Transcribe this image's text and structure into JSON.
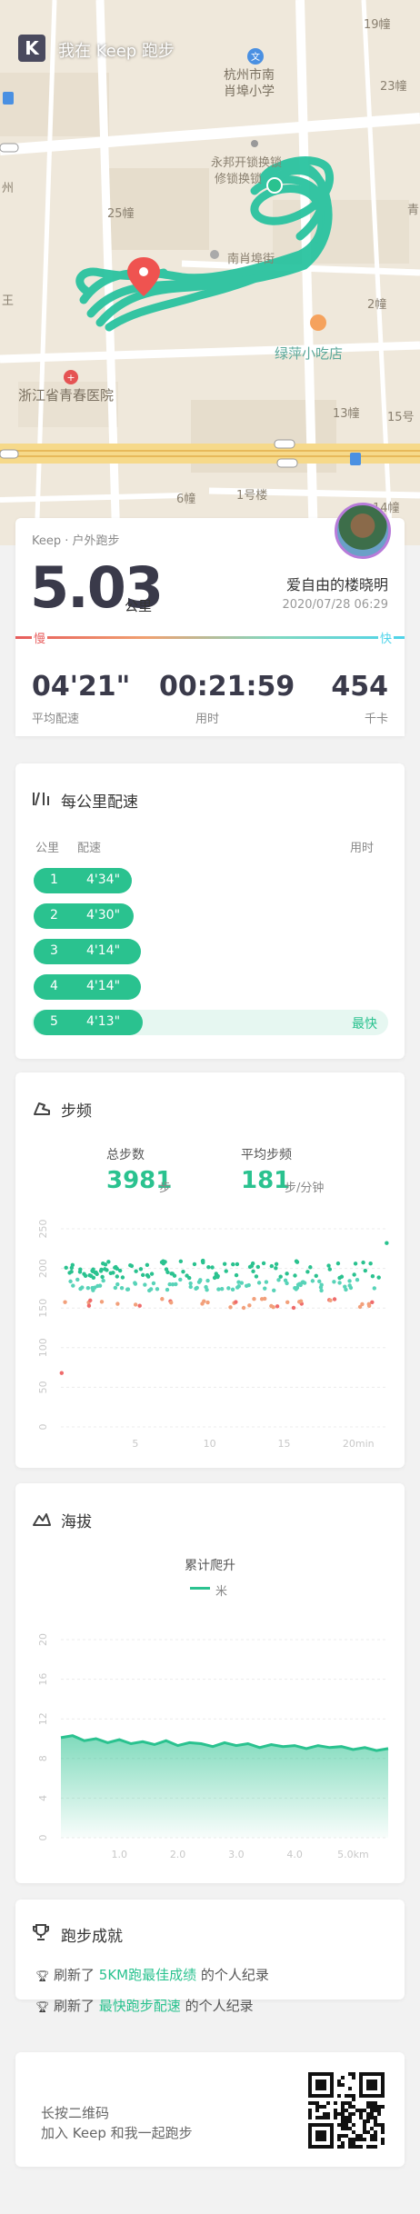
{
  "header": {
    "logo_letter": "K",
    "title": "我在 Keep 跑步"
  },
  "map_labels": [
    {
      "text": "19幢"
    },
    {
      "text": "23幢"
    },
    {
      "text": "杭州市南"
    },
    {
      "text": "肖埠小学"
    },
    {
      "text": "永邦开锁换锁"
    },
    {
      "text": "修锁换锁"
    },
    {
      "text": "25幢"
    },
    {
      "text": "南肖埠街"
    },
    {
      "text": "2幢"
    },
    {
      "text": "绿萍小吃店"
    },
    {
      "text": "浙江省青春医院"
    },
    {
      "text": "13幢"
    },
    {
      "text": "15号"
    },
    {
      "text": "6幢"
    },
    {
      "text": "1号楼"
    },
    {
      "text": "14幢"
    },
    {
      "text": "青"
    },
    {
      "text": "王"
    },
    {
      "text": "州"
    }
  ],
  "summary": {
    "source": "Keep · 户外跑步",
    "distance": "5.03",
    "distance_unit": "公里",
    "user_name": "爱自由的楼晓明",
    "datetime": "2020/07/28 06:29",
    "slow_label": "慢",
    "fast_label": "快",
    "stats": [
      {
        "value": "04'21\"",
        "label": "平均配速"
      },
      {
        "value": "00:21:59",
        "label": "用时"
      },
      {
        "value": "454",
        "label": "千卡"
      }
    ]
  },
  "pace_section": {
    "title": "每公里配速",
    "col_km": "公里",
    "col_pace": "配速",
    "col_time": "用时",
    "rows": [
      {
        "km": "1",
        "pace": "4'34\"",
        "fraction": 0.9,
        "tag": ""
      },
      {
        "km": "2",
        "pace": "4'30\"",
        "fraction": 0.92,
        "tag": ""
      },
      {
        "km": "3",
        "pace": "4'14\"",
        "fraction": 0.98,
        "tag": ""
      },
      {
        "km": "4",
        "pace": "4'14\"",
        "fraction": 0.98,
        "tag": ""
      },
      {
        "km": "5",
        "pace": "4'13\"",
        "fraction": 1.0,
        "tag": "最快"
      }
    ]
  },
  "cadence_section": {
    "title": "步频",
    "total_steps_label": "总步数",
    "total_steps": "3981",
    "steps_unit": "步",
    "avg_label": "平均步频",
    "avg_value": "181",
    "avg_unit": "步/分钟"
  },
  "chart_data": [
    {
      "type": "scatter",
      "title": "步频",
      "xlabel": "",
      "ylabel": "",
      "ylim": [
        0,
        250
      ],
      "xlim": [
        0,
        22
      ],
      "y_ticks": [
        "0",
        "50",
        "100",
        "150",
        "200",
        "250"
      ],
      "x_ticks": [
        "5",
        "10",
        "15",
        "20min"
      ],
      "x_tick_values": [
        5,
        10,
        15,
        20
      ],
      "grid": true,
      "colors": {
        "high": "#2ac28f",
        "mid": "#58d3b8",
        "low": "#f2a07b",
        "lowest": "#ef6b6b"
      }
    },
    {
      "type": "area",
      "title": "海拔",
      "subtitle": "累计爬升",
      "legend": "米",
      "xlabel": "",
      "ylabel": "",
      "ylim": [
        0,
        20
      ],
      "xlim": [
        0,
        5.6
      ],
      "y_ticks": [
        "0",
        "4",
        "8",
        "12",
        "16",
        "20"
      ],
      "x_ticks": [
        "1.0",
        "2.0",
        "3.0",
        "4.0",
        "5.0km"
      ],
      "x_tick_values": [
        1,
        2,
        3,
        4,
        5
      ],
      "x": [
        0,
        0.2,
        0.4,
        0.6,
        0.8,
        1.0,
        1.2,
        1.4,
        1.6,
        1.8,
        2.0,
        2.2,
        2.4,
        2.6,
        2.8,
        3.0,
        3.2,
        3.4,
        3.6,
        3.8,
        4.0,
        4.2,
        4.4,
        4.6,
        4.8,
        5.0,
        5.2,
        5.4,
        5.6
      ],
      "y": [
        10.1,
        10.3,
        9.8,
        10.0,
        9.6,
        9.9,
        9.5,
        9.7,
        9.4,
        9.8,
        9.3,
        9.6,
        9.5,
        9.2,
        9.6,
        9.3,
        9.5,
        9.1,
        9.4,
        9.2,
        9.3,
        9.0,
        9.3,
        9.1,
        9.2,
        8.9,
        9.1,
        8.8,
        9.0
      ],
      "grid": true,
      "colors": {
        "line": "#2ac28f"
      }
    }
  ],
  "elevation_section": {
    "title": "海拔",
    "cumulative_label": "累计爬升",
    "legend_unit": "米"
  },
  "achievement_section": {
    "title": "跑步成就",
    "items": [
      {
        "prefix": "刷新了 ",
        "highlight": "5KM跑最佳成绩",
        "suffix": " 的个人纪录"
      },
      {
        "prefix": "刷新了 ",
        "highlight": "最快跑步配速",
        "suffix": " 的个人纪录"
      }
    ]
  },
  "footer": {
    "line1": "长按二维码",
    "line2": "加入 Keep 和我一起跑步"
  },
  "colors": {
    "brand": "#2ac28f",
    "slow": "#e75c5c",
    "fast": "#4fd4ea",
    "text": "#333333"
  }
}
